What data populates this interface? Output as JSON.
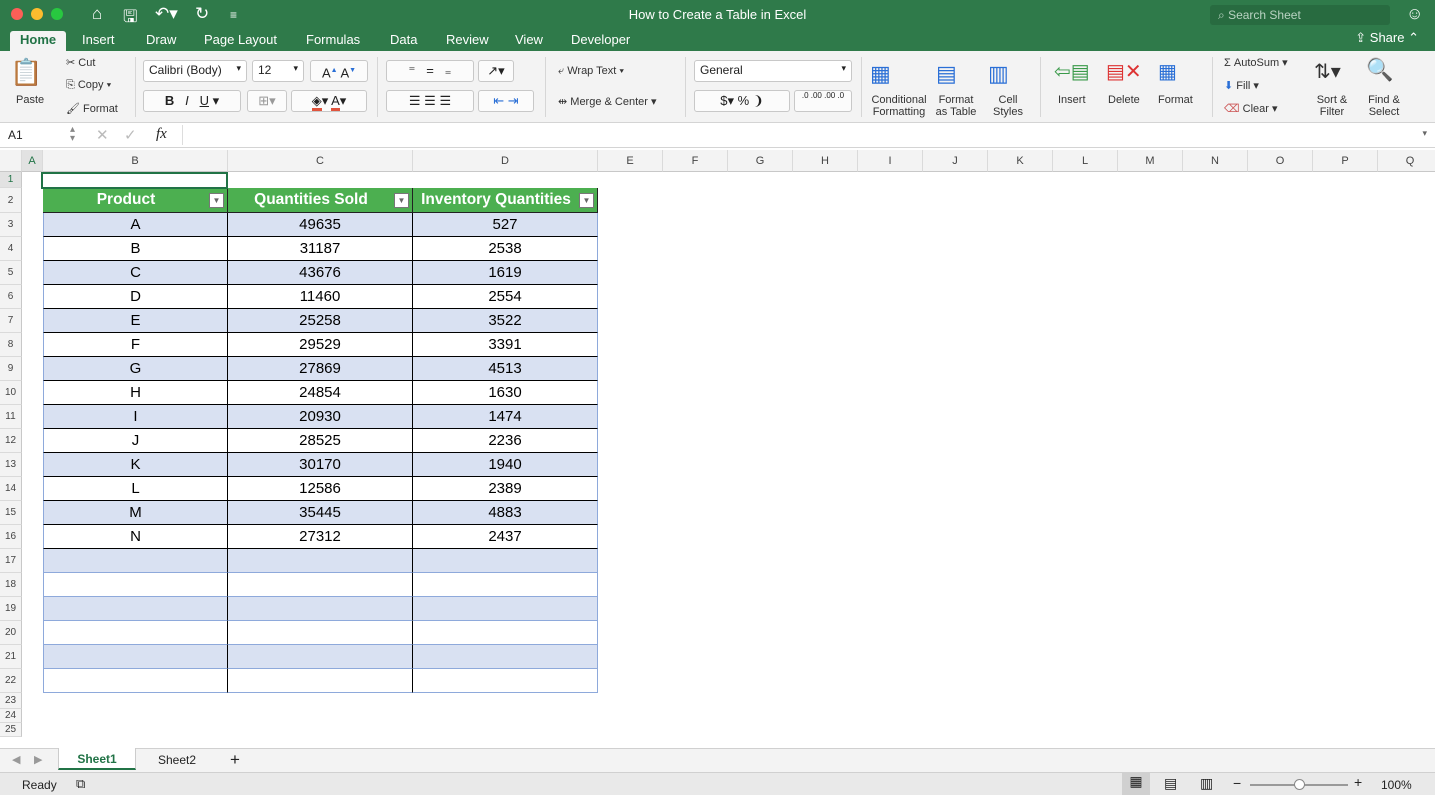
{
  "window": {
    "title": "How to Create a Table in Excel",
    "search_placeholder": "Search Sheet",
    "share": "Share"
  },
  "tabs": [
    "Home",
    "Insert",
    "Draw",
    "Page Layout",
    "Formulas",
    "Data",
    "Review",
    "View",
    "Developer"
  ],
  "ribbon": {
    "paste": "Paste",
    "cut": "Cut",
    "copy": "Copy",
    "format_painter": "Format",
    "font": "Calibri (Body)",
    "size": "12",
    "bold": "B",
    "italic": "I",
    "underline": "U",
    "wrap_text": "Wrap Text",
    "merge_center": "Merge & Center",
    "number_format": "General",
    "currency": "$",
    "percent": "%",
    "comma": "❩",
    "inc_dec": ".0 .00",
    "dec_dec": ".00 .0",
    "conditional_formatting": "Conditional Formatting",
    "format_as_table": "Format as Table",
    "cell_styles": "Cell Styles",
    "insert": "Insert",
    "delete": "Delete",
    "format": "Format",
    "autosum": "AutoSum",
    "fill": "Fill",
    "clear": "Clear",
    "sort_filter": "Sort & Filter",
    "find_select": "Find & Select"
  },
  "formula_bar": {
    "name_box": "A1",
    "fx": "fx",
    "value": ""
  },
  "columns": [
    "A",
    "B",
    "C",
    "D",
    "E",
    "F",
    "G",
    "H",
    "I",
    "J",
    "K",
    "L",
    "M",
    "N",
    "O",
    "P",
    "Q"
  ],
  "table": {
    "headers": [
      "Product",
      "Quantities Sold",
      "Inventory Quantities"
    ],
    "rows": [
      [
        "A",
        "49635",
        "527"
      ],
      [
        "B",
        "31187",
        "2538"
      ],
      [
        "C",
        "43676",
        "1619"
      ],
      [
        "D",
        "11460",
        "2554"
      ],
      [
        "E",
        "25258",
        "3522"
      ],
      [
        "F",
        "29529",
        "3391"
      ],
      [
        "G",
        "27869",
        "4513"
      ],
      [
        "H",
        "24854",
        "1630"
      ],
      [
        "I",
        "20930",
        "1474"
      ],
      [
        "J",
        "28525",
        "2236"
      ],
      [
        "K",
        "30170",
        "1940"
      ],
      [
        "L",
        "12586",
        "2389"
      ],
      [
        "M",
        "35445",
        "4883"
      ],
      [
        "N",
        "27312",
        "2437"
      ]
    ],
    "empty_rows": 6,
    "band_color": "#d9e1f2",
    "header_color": "#4caf50"
  },
  "sheets": [
    "Sheet1",
    "Sheet2"
  ],
  "status": {
    "ready": "Ready",
    "zoom": "100%",
    "zoom_level": 100
  }
}
